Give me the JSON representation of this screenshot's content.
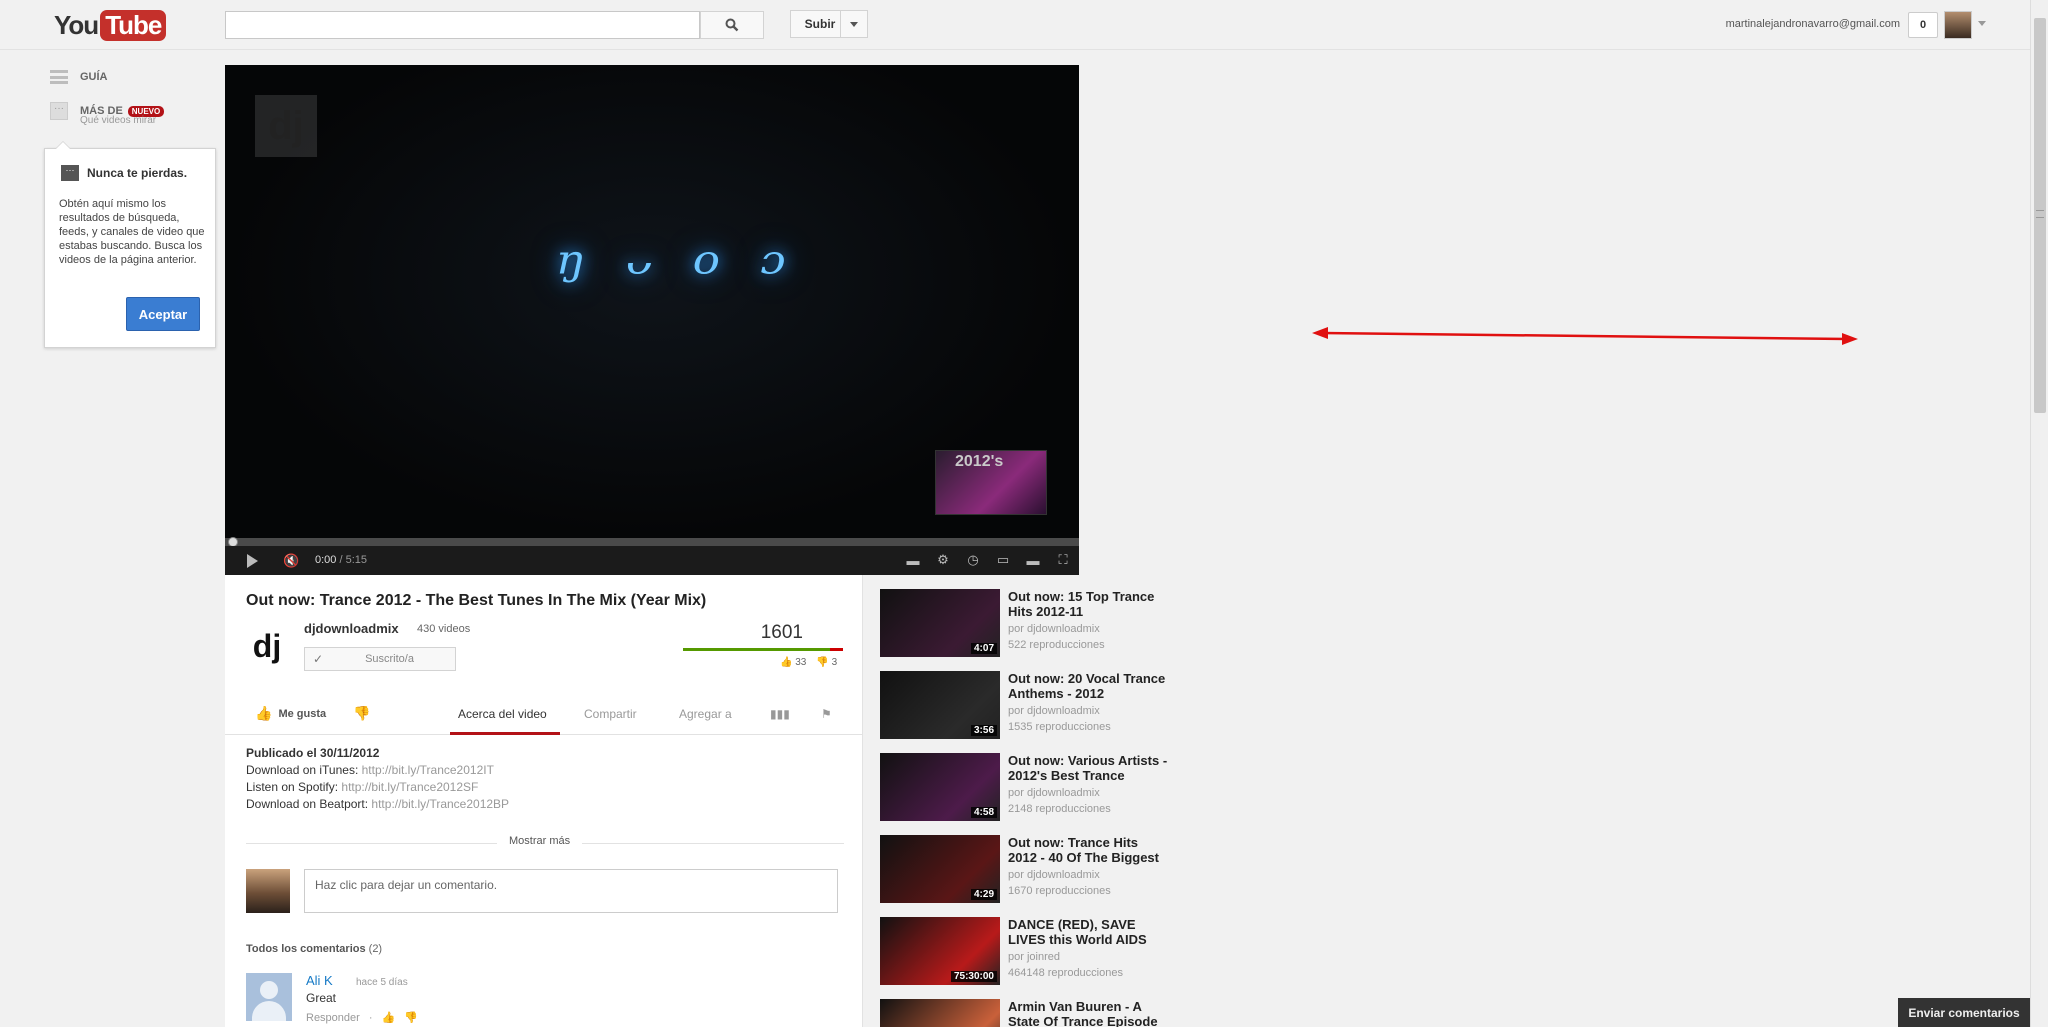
{
  "header": {
    "logo_you": "You",
    "logo_tube": "Tube",
    "search_placeholder": "",
    "upload_label": "Subir",
    "user_email": "martinalejandronavarro@gmail.com",
    "notifications": "0"
  },
  "guide": {
    "guide_label": "GUÍA",
    "more_label": "MÁS DE",
    "new_badge": "NUEVO",
    "more_sub": "Qué videos mirar"
  },
  "popup": {
    "title": "Nunca te pierdas.",
    "body": "Obtén aquí mismo los resultados de búsqueda, feeds, y canales de video que estabas buscando. Busca los videos de la página anterior.",
    "button": "Aceptar"
  },
  "player": {
    "watermark": "dj",
    "glow_text": "ᵑ ᵕ ᵒ ᵓ",
    "corner_text": "2012's",
    "time_current": "0:00",
    "time_total": "/ 5:15",
    "progress": 0
  },
  "video": {
    "title": "Out now: Trance 2012 - The Best Tunes In The Mix (Year Mix)",
    "channel_avatar": "dj",
    "channel_name": "djdownloadmix",
    "channel_videos": "430 videos",
    "subscribed_label": "Suscrito/a",
    "views": "1601",
    "likes": "33",
    "dislikes": "3",
    "like_ratio": 0.917,
    "like_button": "Me gusta",
    "tabs": [
      "Acerca del video",
      "Compartir",
      "Agregar a"
    ],
    "published": "Publicado el 30/11/2012",
    "desc_lines": [
      {
        "label": "Download on iTunes: ",
        "link": "http://bit.ly/Trance2012IT"
      },
      {
        "label": "Listen on Spotify: ",
        "link": "http://bit.ly/Trance2012SF"
      },
      {
        "label": "Download on Beatport: ",
        "link": "http://bit.ly/Trance2012BP"
      }
    ],
    "show_more": "Mostrar más",
    "comment_placeholder": "Haz clic para dejar un comentario.",
    "all_comments_label": "Todos los comentarios",
    "all_comments_count": "(2)"
  },
  "comment": {
    "author": "Ali K",
    "time": "hace 5 días",
    "text": "Great",
    "reply": "Responder"
  },
  "related": [
    {
      "title": "Out now: 15 Top Trance Hits 2012-11",
      "by": "por djdownloadmix",
      "views": "522 reproducciones",
      "duration": "4:07",
      "color": "#3b1a33"
    },
    {
      "title": "Out now: 20 Vocal Trance Anthems - 2012",
      "by": "por djdownloadmix",
      "views": "1535 reproducciones",
      "duration": "3:56",
      "color": "#2a2a2a"
    },
    {
      "title": "Out now: Various Artists - 2012's Best Trance",
      "by": "por djdownloadmix",
      "views": "2148 reproducciones",
      "duration": "4:58",
      "color": "#4d1b4a"
    },
    {
      "title": "Out now: Trance Hits 2012 - 40 Of The Biggest",
      "by": "por djdownloadmix",
      "views": "1670 reproducciones",
      "duration": "4:29",
      "color": "#5a1616"
    },
    {
      "title": "DANCE (RED), SAVE LIVES this World AIDS",
      "by": "por joinred",
      "views": "464148 reproducciones",
      "duration": "75:30:00",
      "color": "#b81a1a"
    },
    {
      "title": "Armin Van Buuren - A State Of Trance Episode",
      "by": "",
      "views": "",
      "duration": "",
      "color": "#c9603a"
    }
  ],
  "footer": {
    "feedback": "Enviar comentarios"
  },
  "colors": {
    "brand_red": "#c4302b",
    "accent_blue": "#3a7dd2",
    "link_blue": "#167ac6",
    "annotation_red": "#e01010"
  }
}
